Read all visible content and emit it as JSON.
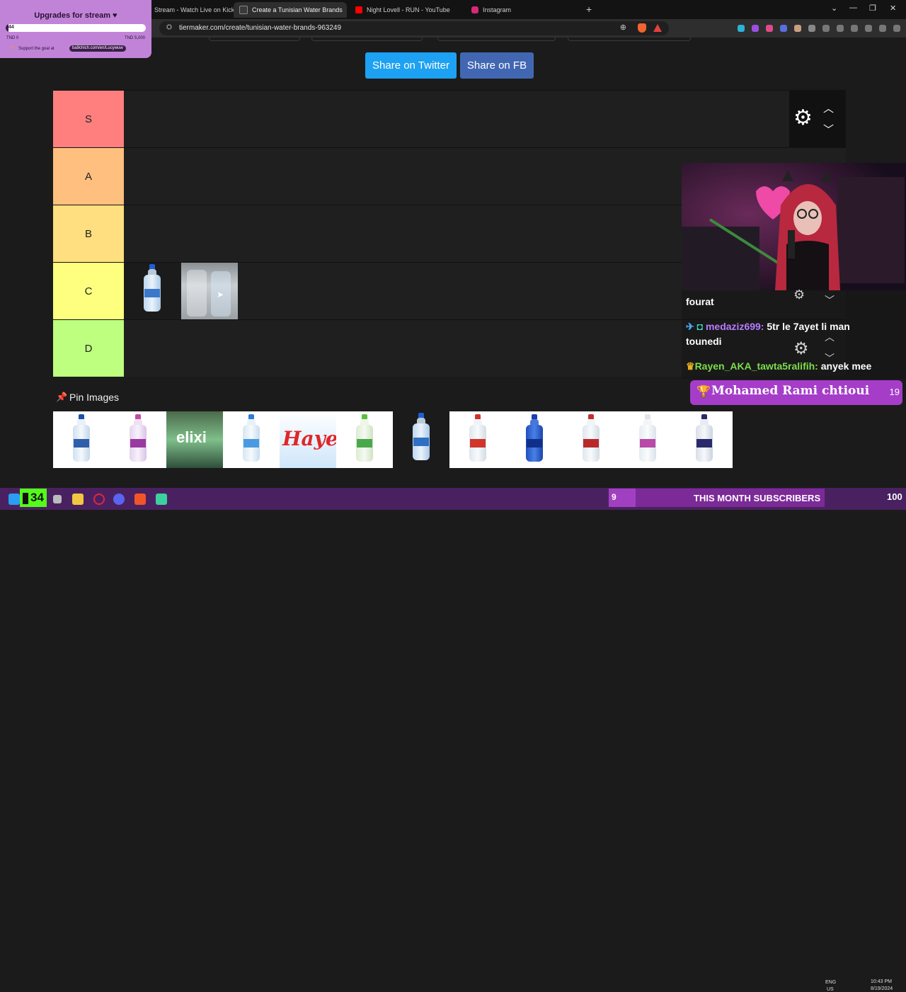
{
  "browser": {
    "tabs": [
      {
        "label": "Stream - Watch Live on Kick",
        "active": false
      },
      {
        "label": "Create a Tunisian Water Brands",
        "active": true
      },
      {
        "label": "Night Lovell - RUN - YouTube",
        "active": false
      },
      {
        "label": "Instagram",
        "active": false
      }
    ],
    "url": "tiermaker.com/create/tunisian-water-brands-963249"
  },
  "share": {
    "twitter": "Share on Twitter",
    "facebook": "Share on FB"
  },
  "tiers": [
    {
      "label": "S",
      "color": "#ff7f7f"
    },
    {
      "label": "A",
      "color": "#ffbf7f"
    },
    {
      "label": "B",
      "color": "#ffdf7f"
    },
    {
      "label": "C",
      "color": "#ffff7f"
    },
    {
      "label": "D",
      "color": "#bfff7f"
    }
  ],
  "tier_items": {
    "C": [
      "water-bottle-blue-label",
      "water-bottles-pack"
    ]
  },
  "pin_images": {
    "title": "Pin Images",
    "items": [
      "bottle-1",
      "bottle-2",
      "elixir",
      "bottle-4",
      "Hayet",
      "bottle-6",
      "Marwa",
      "bottle-8",
      "bottle-9",
      "bottle-10",
      "Safia",
      "bottle-12"
    ],
    "hayet_text": "Hayet",
    "elixir_text": "elixi"
  },
  "overlay": {
    "goal": {
      "title": "Upgrades for stream ♥",
      "current": "44",
      "progress": 0.0088,
      "min": "TND 0",
      "max": "TND 5,000",
      "support_text": "Support the goal at",
      "support_link": "ba9chich.com/en/Lucywuw"
    },
    "chat": [
      {
        "user": "",
        "message": "fourat",
        "user_color": "#ffffff"
      },
      {
        "user": "medaziz699:",
        "message": " 5tr le 7ayet li man tounedi",
        "user_color": "#b77cff"
      },
      {
        "user": "Rayen_AKA_tawta5ralifih:",
        "message": " anyek mee",
        "user_color": "#7cde4a"
      }
    ],
    "latest_follower": {
      "name": "Mohamed Rami chtioui",
      "count": "19"
    }
  },
  "taskbar": {
    "kick_count": "34",
    "subs_count": "9",
    "subs_label": "THIS MONTH SUBSCRIBERS",
    "lang": "ENG",
    "region": "US",
    "time": "10:43 PM",
    "date": "8/19/2024",
    "battery": "100"
  }
}
